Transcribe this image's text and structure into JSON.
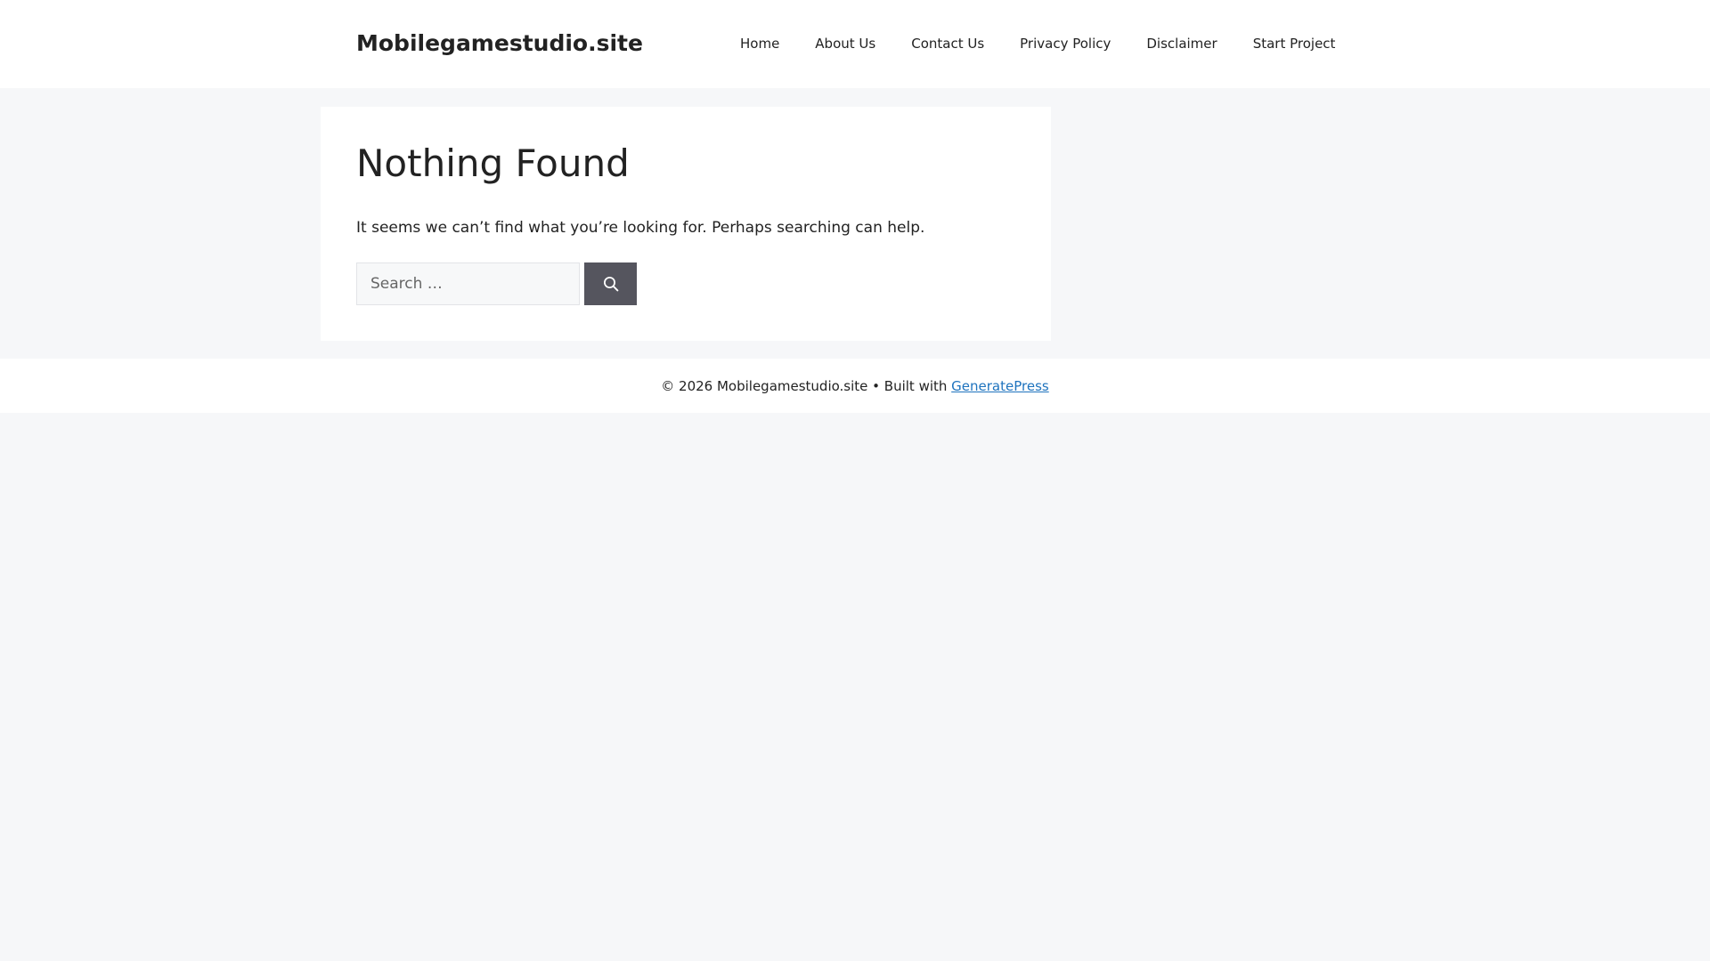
{
  "header": {
    "site_title": "Mobilegamestudio.site",
    "nav": [
      {
        "label": "Home"
      },
      {
        "label": "About Us"
      },
      {
        "label": "Contact Us"
      },
      {
        "label": "Privacy Policy"
      },
      {
        "label": "Disclaimer"
      },
      {
        "label": "Start Project"
      }
    ]
  },
  "main": {
    "title": "Nothing Found",
    "message": "It seems we can’t find what you’re looking for. Perhaps searching can help.",
    "search": {
      "placeholder": "Search …",
      "value": "",
      "button_icon": "search-icon"
    }
  },
  "footer": {
    "copyright": "© 2026 Mobilegamestudio.site • Built with ",
    "link_label": "GeneratePress"
  },
  "colors": {
    "page_background": "#f6f7f9",
    "panel_background": "#ffffff",
    "text": "#222222",
    "search_button": "#55555e",
    "link": "#1e73be"
  }
}
